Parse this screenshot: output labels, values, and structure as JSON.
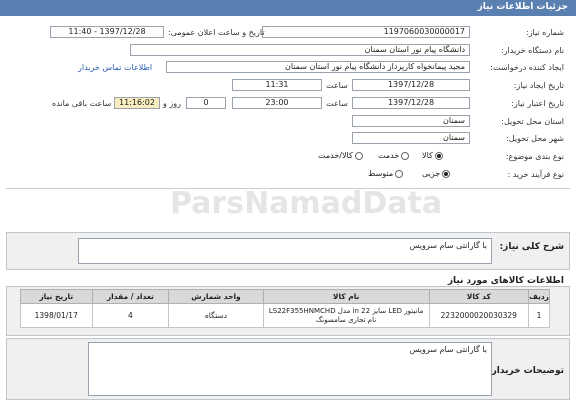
{
  "header": {
    "title": "جزئیات اطلاعات نیاز"
  },
  "form": {
    "need_number_label": "شماره نیاز:",
    "need_number": "1197060030000017",
    "announce_label": "تاریخ و ساعت اعلان عمومی:",
    "announce_value": "1397/12/28 - 11:40",
    "buyer_label": "نام دستگاه خریدار:",
    "buyer_value": "دانشگاه  پیام نور استان سمنان",
    "creator_label": "ایجاد کننده درخواست:",
    "creator_value": "مجید پیمانخواه کارپرداز دانشگاه  پیام نور استان سمنان",
    "contact_link": "اطلاعات تماس خریدار",
    "created_label": "تاریخ ایجاد نیاز:",
    "created_date": "1397/12/28",
    "hour_label": "ساعت",
    "created_time": "11:31",
    "validity_label": "تاریخ اعتبار نیاز:",
    "validity_date": "1397/12/28",
    "validity_time": "23:00",
    "days_value": "0",
    "day_and_label": "روز و",
    "remaining_time": "11:16:02",
    "remaining_label": "ساعت باقی مانده",
    "province_label": "استان محل تحویل:",
    "province_value": "سمنان",
    "city_label": "شهر محل تحویل:",
    "city_value": "سمنان",
    "category_label": "نوع بندی موضوع:",
    "category_options": [
      "کالا",
      "خدمت",
      "کالا/خدمت"
    ],
    "process_label": "نوع فرآیند خرید :",
    "process_options": [
      "جزیی",
      "متوسط"
    ]
  },
  "summary": {
    "label": "شرح کلی نیاز:",
    "value": "با گارانتی سام سرویس"
  },
  "items": {
    "title": "اطلاعات کالاهای مورد نیاز",
    "columns": [
      "ردیف",
      "کد کالا",
      "نام کالا",
      "واحد شمارش",
      "تعداد / مقدار",
      "تاریخ نیاز"
    ],
    "rows": [
      {
        "row": "1",
        "code": "2232000020030329",
        "name": "مانیتور LED سایز 22 in مدل LS22F355HNMCHD نام تجاری سامسونگ",
        "unit": "دستگاه",
        "qty": "4",
        "date": "1398/01/17"
      }
    ]
  },
  "buyer_notes": {
    "label": "توضیحات خریدار:",
    "value": "با گارانتی سام سرویس"
  },
  "watermark": "ParsNamadData"
}
